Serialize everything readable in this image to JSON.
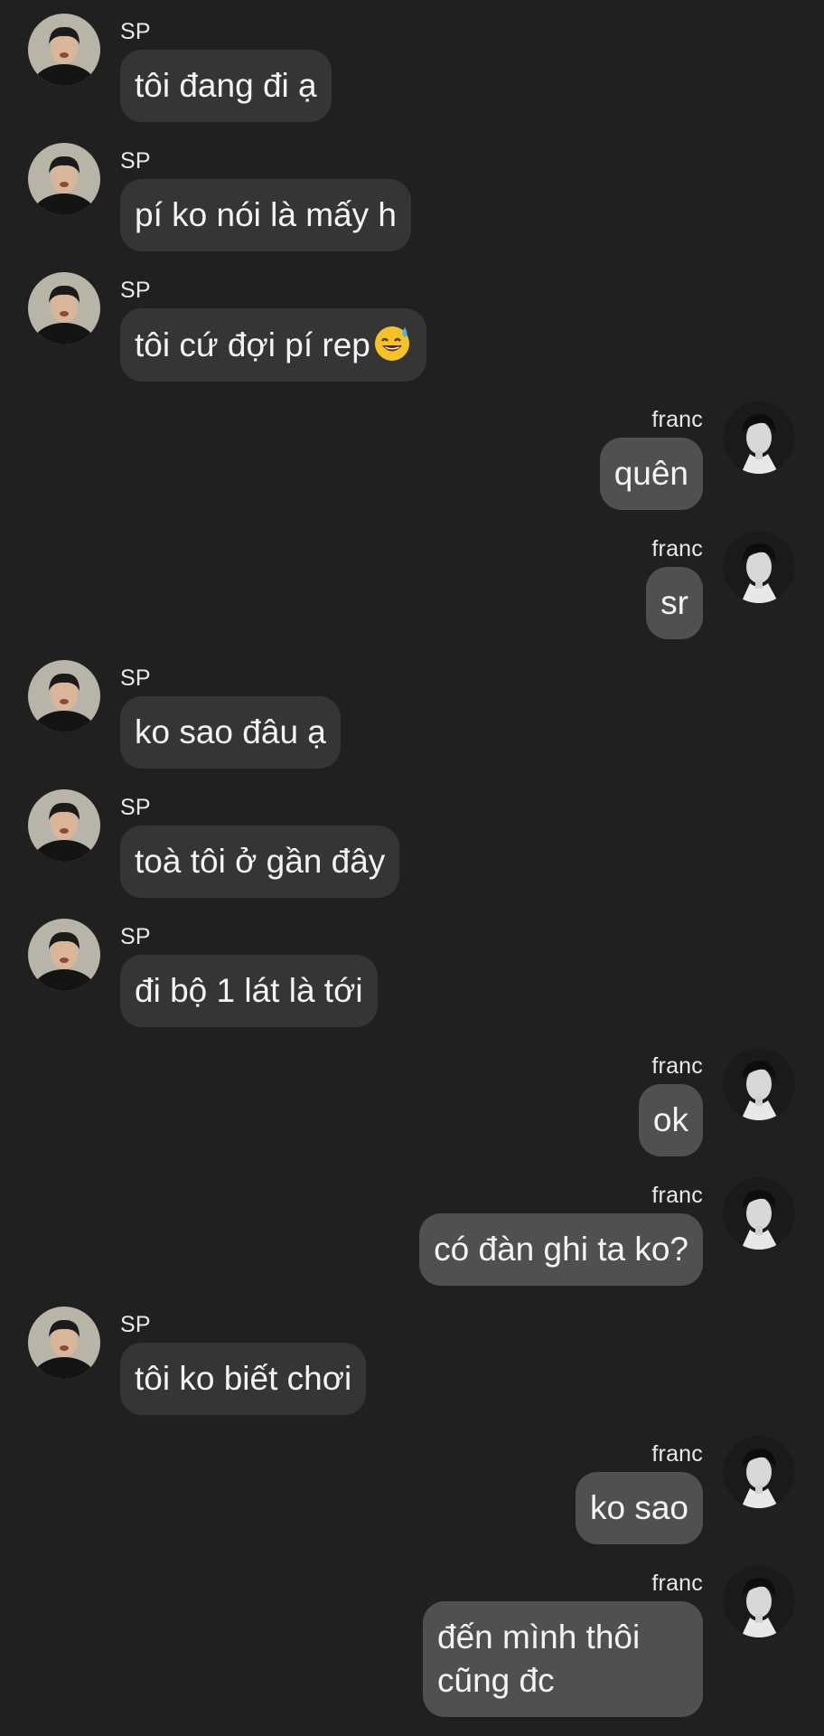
{
  "conversation": {
    "messages": [
      {
        "sender": "SP",
        "text": "tôi đang đi ạ",
        "side": "left"
      },
      {
        "sender": "SP",
        "text": "pí ko nói là mấy h",
        "side": "left"
      },
      {
        "sender": "SP",
        "text": "tôi cứ đợi pí rep",
        "emoji": "sweat-smile-emoji",
        "side": "left"
      },
      {
        "sender": "franc",
        "text": "quên",
        "side": "right"
      },
      {
        "sender": "franc",
        "text": "sr",
        "side": "right"
      },
      {
        "sender": "SP",
        "text": "ko sao đâu ạ",
        "side": "left"
      },
      {
        "sender": "SP",
        "text": "toà tôi ở gần đây",
        "side": "left"
      },
      {
        "sender": "SP",
        "text": "đi bộ 1 lát là tới",
        "side": "left"
      },
      {
        "sender": "franc",
        "text": "ok",
        "side": "right"
      },
      {
        "sender": "franc",
        "text": "có đàn ghi ta ko?",
        "side": "right"
      },
      {
        "sender": "SP",
        "text": "tôi ko biết chơi",
        "side": "left"
      },
      {
        "sender": "franc",
        "text": "ko sao",
        "side": "right"
      },
      {
        "sender": "franc",
        "text": "đến mình thôi cũng đc",
        "side": "right"
      }
    ]
  },
  "colors": {
    "background": "#202020",
    "incoming_bubble": "#353535",
    "outgoing_bubble": "#505050",
    "text": "#f4f4f4"
  }
}
